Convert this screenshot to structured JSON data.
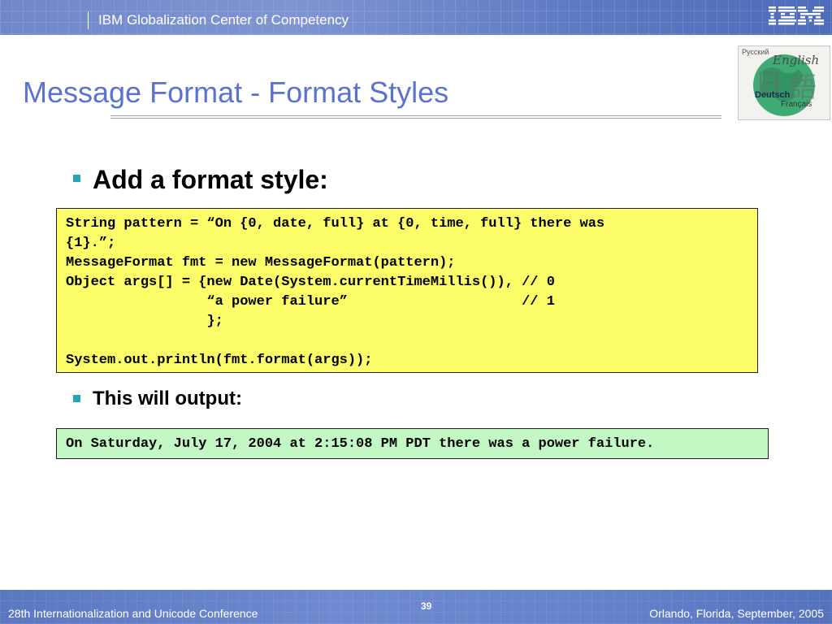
{
  "header": {
    "title": "IBM Globalization Center of Competency",
    "logo_text": "IBM"
  },
  "slide": {
    "title": "Message Format - Format Styles"
  },
  "language_image": {
    "words": [
      "Русский",
      "English",
      "Deutsch",
      "Français",
      "日本語"
    ]
  },
  "bullets": [
    {
      "text": "Add a format style:"
    },
    {
      "text": "This will output:"
    }
  ],
  "code": {
    "lines": [
      "String pattern = “On {0, date, full} at {0, time, full} there was",
      "{1}.”;",
      "MessageFormat fmt = new MessageFormat(pattern);",
      "Object args[] = {new Date(System.currentTimeMillis()), // 0",
      "                 “a power failure”                     // 1",
      "                 };",
      "",
      "System.out.println(fmt.format(args));"
    ]
  },
  "output": {
    "text": "On Saturday, July 17, 2004 at 2:15:08 PM PDT there was a power failure."
  },
  "footer": {
    "left": "28th Internationalization and Unicode Conference",
    "page": "39",
    "right": "Orlando, Florida, September, 2005"
  },
  "colors": {
    "title_blue": "#5b73d0",
    "bullet_teal": "#22a7b6",
    "code_yellow": "#fdfd6a",
    "output_green": "#c3f7c3",
    "band_blue": "#6f86c9"
  }
}
